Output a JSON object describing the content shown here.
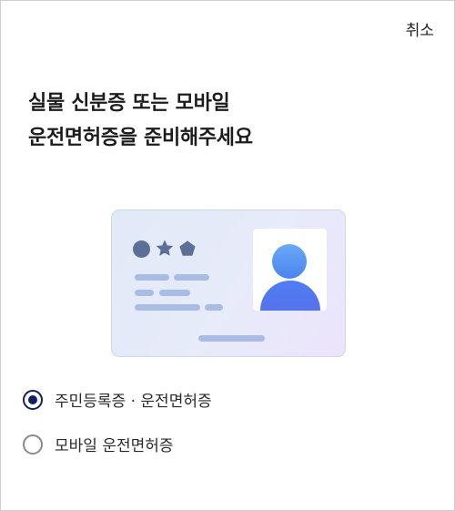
{
  "header": {
    "cancel_label": "취소"
  },
  "title": {
    "line1": "실물 신분증 또는 모바일",
    "line2": "운전면허증을 준비해주세요"
  },
  "card": {
    "icons": [
      "circle-icon",
      "star-icon",
      "pentagon-icon"
    ],
    "photo_icon": "person-icon"
  },
  "options": [
    {
      "label": "주민등록증 · 운전면허증",
      "selected": true
    },
    {
      "label": "모바일 운전면허증",
      "selected": false
    }
  ],
  "colors": {
    "radio_selected": "#11205e",
    "radio_unselected": "#8a8a8a",
    "card_bar": "#a9bde4",
    "card_shape": "#5c6f97",
    "avatar": "#4f7df2"
  }
}
